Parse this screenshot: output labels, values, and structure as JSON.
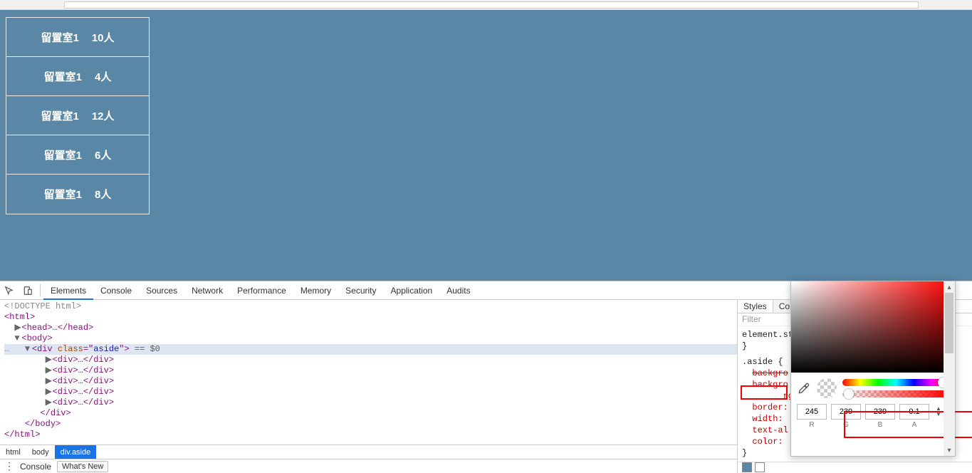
{
  "aside": {
    "items": [
      {
        "label": "留置室1",
        "count": "10人"
      },
      {
        "label": "留置室1",
        "count": "4人"
      },
      {
        "label": "留置室1",
        "count": "12人"
      },
      {
        "label": "留置室1",
        "count": "6人"
      },
      {
        "label": "留置室1",
        "count": "8人"
      }
    ]
  },
  "devtools": {
    "tabs": [
      "Elements",
      "Console",
      "Sources",
      "Network",
      "Performance",
      "Memory",
      "Security",
      "Application",
      "Audits"
    ],
    "active_tab": "Elements",
    "dom": {
      "doctype": "<!DOCTYPE html>",
      "html_open": "<html>",
      "head_collapsed_open": "<head>",
      "head_collapsed_close": "</head>",
      "body_open": "<body>",
      "aside_open_a": "<div ",
      "aside_attr_name": "class",
      "aside_attr_val": "aside",
      "aside_open_b": ">",
      "selected_suffix": " == $0",
      "child_open": "<div>",
      "child_close": "</div>",
      "aside_close": "</div>",
      "body_close": "</body>",
      "html_close": "</html>",
      "ellipsis": "…"
    },
    "breadcrumb": [
      "html",
      "body",
      "div.aside"
    ],
    "console_drawer_label": "Console",
    "whats_new": "What's New",
    "styles": {
      "tabs": [
        "Styles",
        "Co"
      ],
      "filter_placeholder": "Filter",
      "element_style": "element.st",
      "brace_close": "}",
      "rule_selector": ".aside {",
      "props": [
        "backgro",
        "backgro",
        "rg",
        "border:",
        "width:",
        "text-al",
        "color:"
      ],
      "brace_close2": "}",
      "swatch_color": "#5a87a6"
    }
  },
  "color_picker": {
    "r": "245",
    "g": "239",
    "b": "239",
    "a": "0.1",
    "labels": [
      "R",
      "G",
      "B",
      "A"
    ]
  }
}
